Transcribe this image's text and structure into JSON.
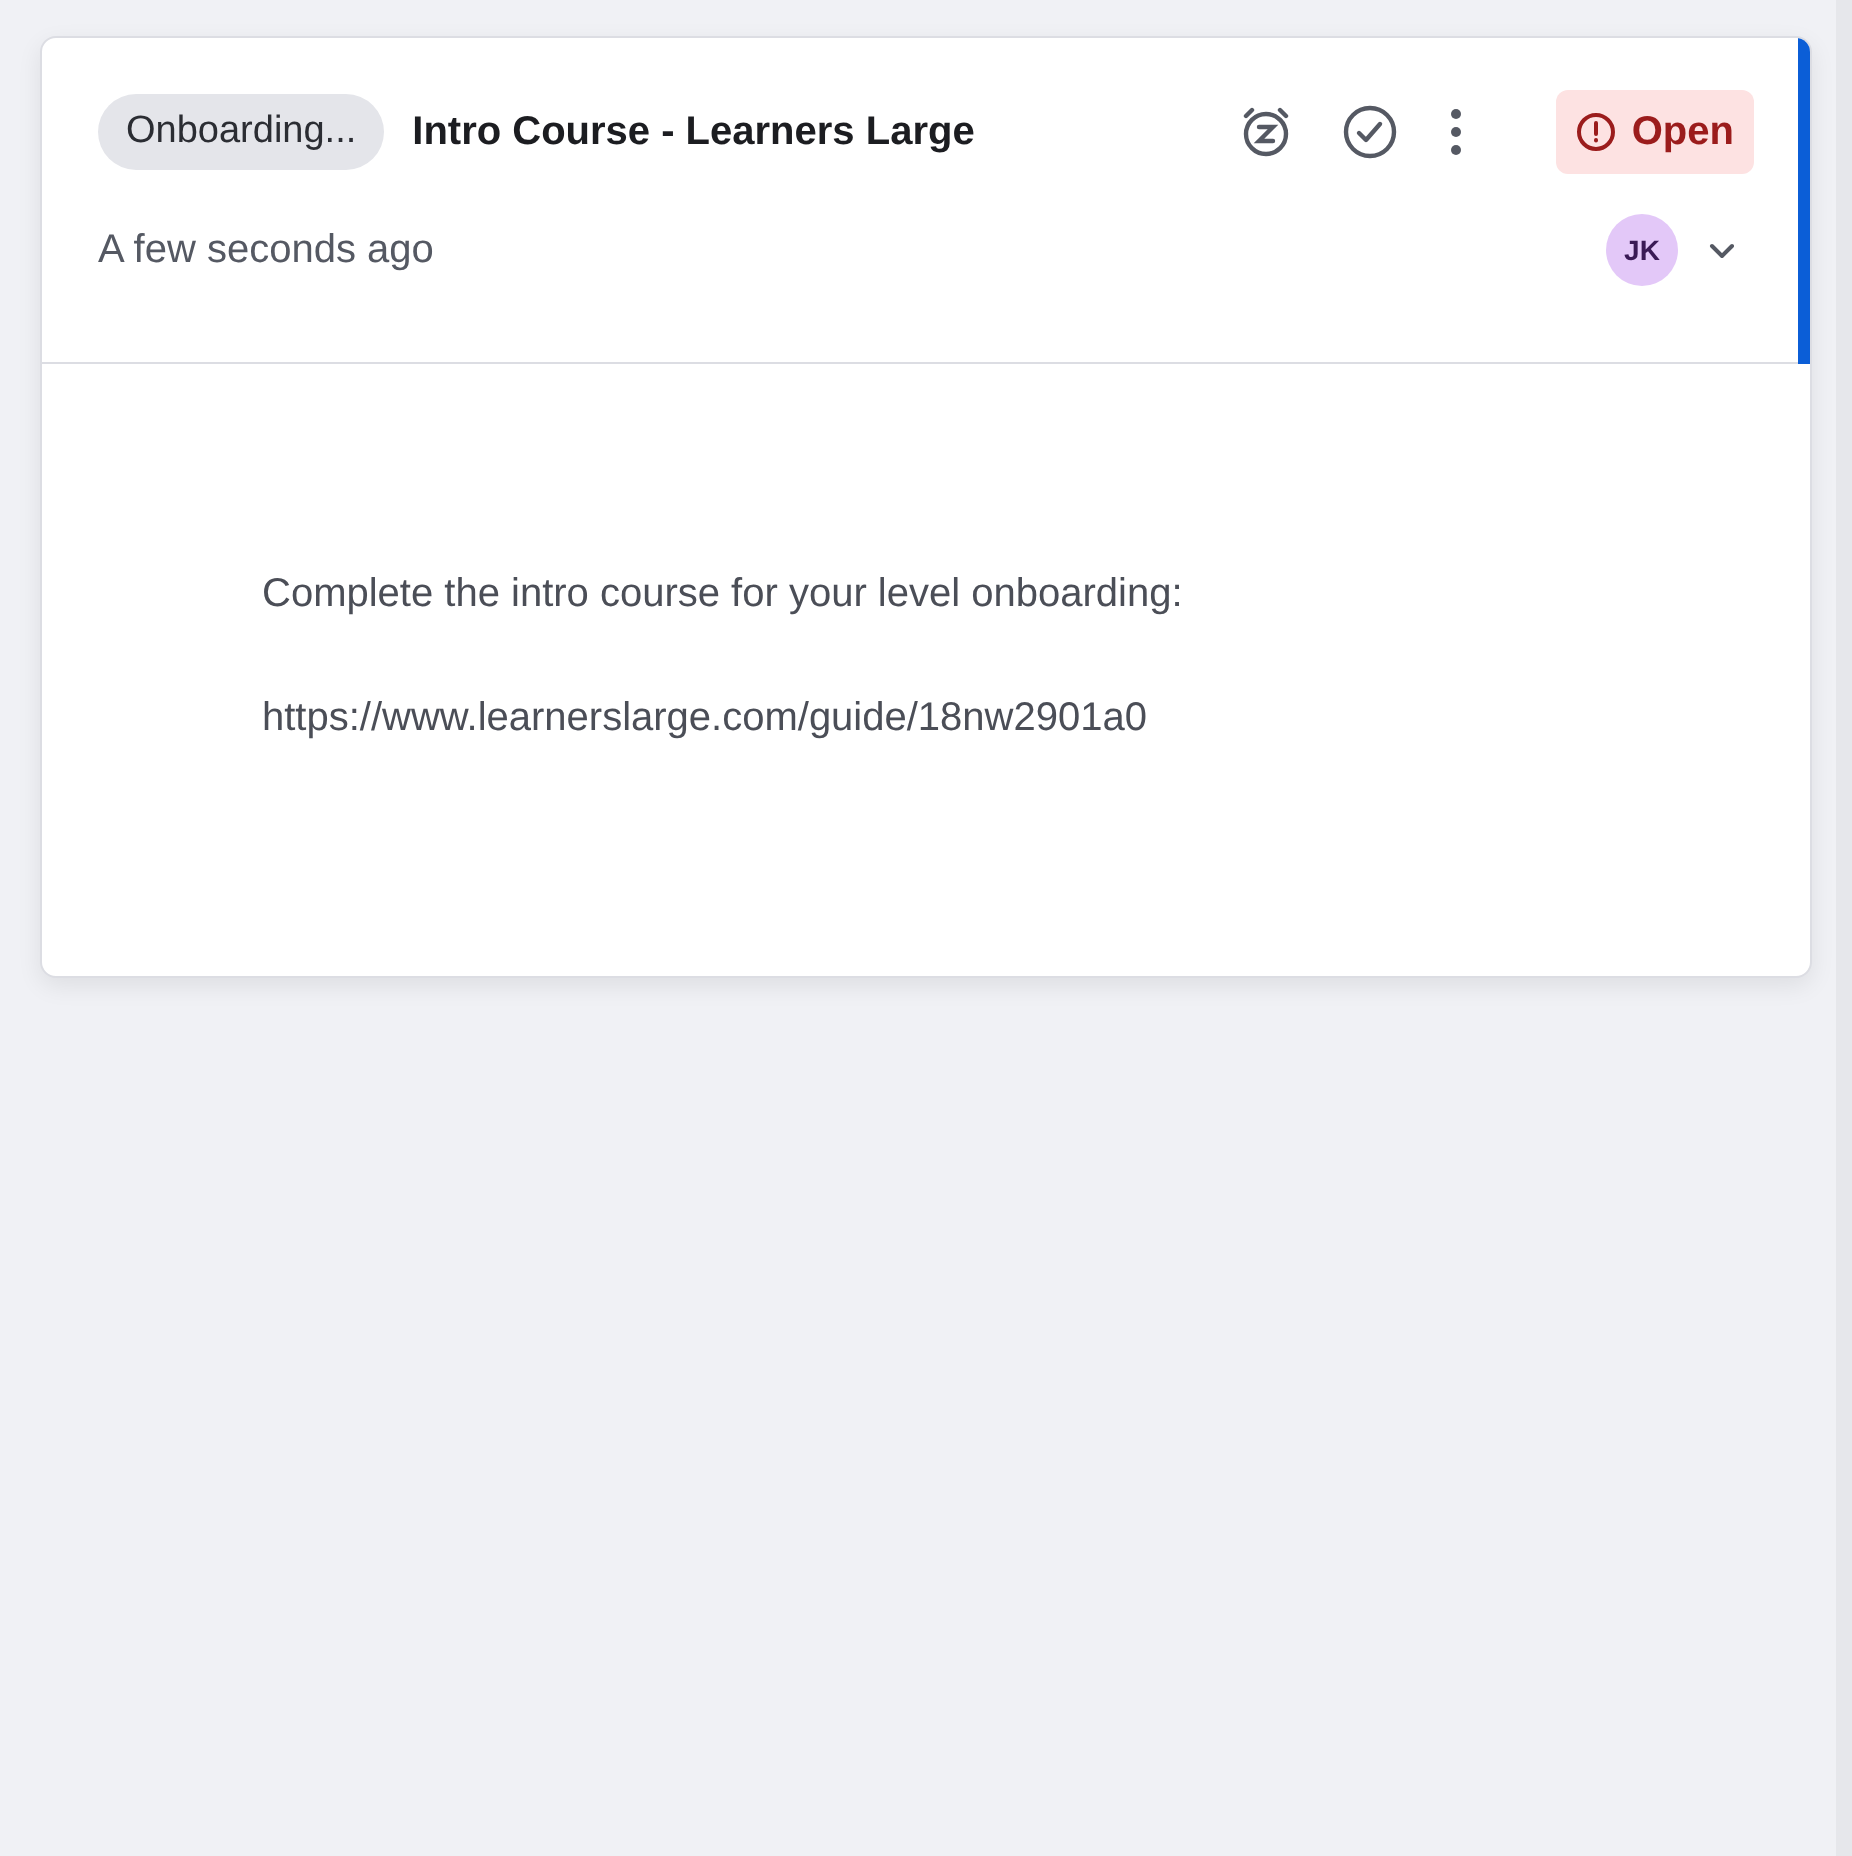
{
  "card": {
    "tag": "Onboarding...",
    "title": "Intro Course - Learners Large",
    "status": {
      "label": "Open",
      "kind": "open"
    },
    "time": "A few seconds ago",
    "assignee": "JK",
    "selected": true,
    "body": [
      "Complete the intro course for your level onboarding:",
      "https://www.learnerslarge.com/guide/18nw2901a0"
    ]
  }
}
